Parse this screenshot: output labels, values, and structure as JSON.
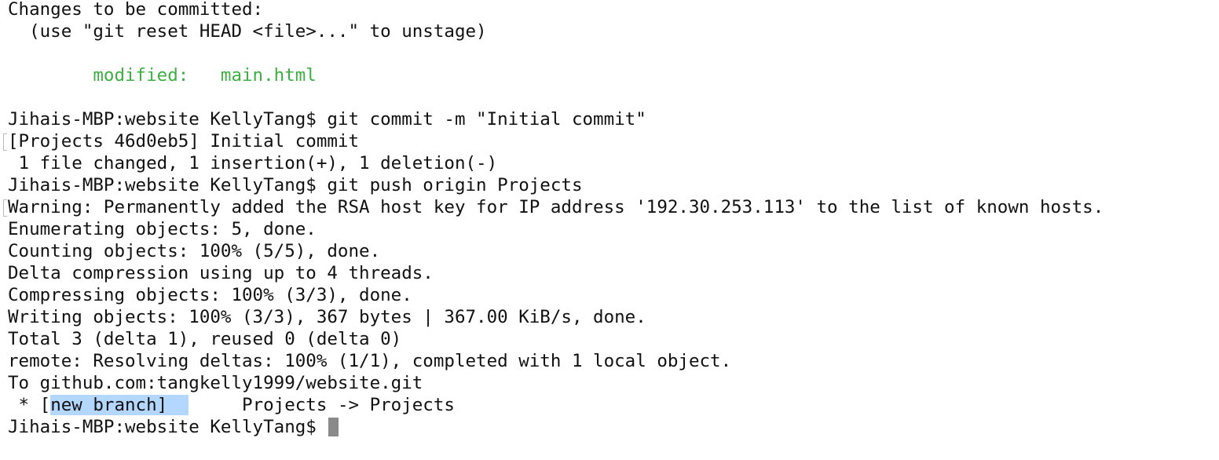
{
  "terminal": {
    "lines": [
      "Changes to be committed:",
      "  (use \"git reset HEAD <file>...\" to unstage)",
      "",
      "        modified:   main.html",
      "",
      "Jihais-MBP:website KellyTang$ git commit -m \"Initial commit\"",
      "[Projects 46d0eb5] Initial commit",
      " 1 file changed, 1 insertion(+), 1 deletion(-)",
      "Jihais-MBP:website KellyTang$ git push origin Projects",
      "Warning: Permanently added the RSA host key for IP address '192.30.253.113' to the list of known hosts.",
      "Enumerating objects: 5, done.",
      "Counting objects: 100% (5/5), done.",
      "Delta compression using up to 4 threads.",
      "Compressing objects: 100% (3/3), done.",
      "Writing objects: 100% (3/3), 367 bytes | 367.00 KiB/s, done.",
      "Total 3 (delta 1), reused 0 (delta 0)",
      "remote: Resolving deltas: 100% (1/1), completed with 1 local object.",
      "To github.com:tangkelly1999/website.git"
    ],
    "branch_line": {
      "prefix": " * [",
      "highlighted": "new branch]  ",
      "rest": "     Projects -> Projects"
    },
    "prompt": "Jihais-MBP:website KellyTang$ ",
    "colors": {
      "text": "#111111",
      "modified": "#3cb043",
      "selection": "#b3d7ff",
      "cursor": "#8a8a8a"
    }
  }
}
